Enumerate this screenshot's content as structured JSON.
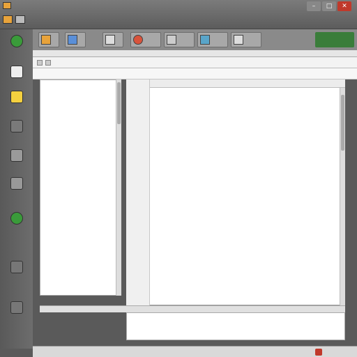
{
  "window": {
    "title": "",
    "controls": {
      "minimize": "–",
      "maximize": "□",
      "close": "✕"
    }
  },
  "colors": {
    "accent": "#f4d03f",
    "ribbon_status": "#3a7d3a",
    "close": "#c0392b"
  },
  "icons": {
    "app": "app-icon",
    "leftbar": [
      "folder-icon",
      "document-icon",
      "edit-icon",
      "settings-icon",
      "database-icon",
      "image-icon",
      "key-icon",
      "tools-icon"
    ]
  },
  "editor": {
    "header_row": "",
    "lines": [
      {
        "n": "",
        "text": ""
      },
      {
        "n": "",
        "text": ""
      },
      {
        "n": "",
        "text": ""
      }
    ]
  },
  "statusbar": {
    "right_label": ""
  },
  "ribbon": {
    "status_label": ""
  }
}
